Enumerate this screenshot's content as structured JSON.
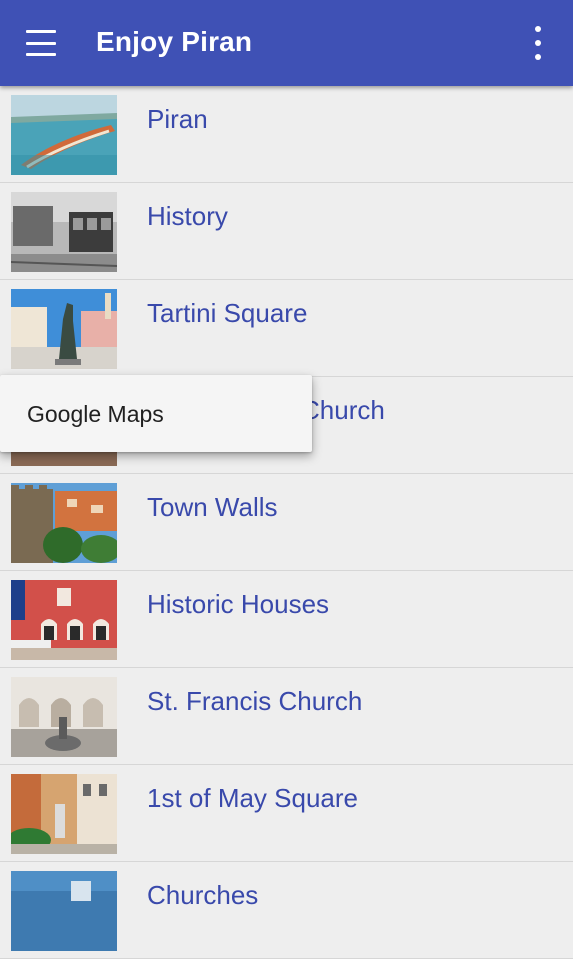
{
  "app_bar": {
    "title": "Enjoy Piran",
    "menu_icon": "hamburger-menu-icon",
    "overflow_icon": "more-vert-icon",
    "color": "#3f51b5"
  },
  "list": {
    "items": [
      {
        "label": "Piran",
        "thumb": "aerial-peninsula-photo"
      },
      {
        "label": "History",
        "thumb": "historic-tram-photo"
      },
      {
        "label": "Tartini Square",
        "thumb": "statue-square-photo"
      },
      {
        "label": "Church",
        "thumb": "church-photo"
      },
      {
        "label": "Town Walls",
        "thumb": "town-walls-photo"
      },
      {
        "label": "Historic Houses",
        "thumb": "venetian-house-photo"
      },
      {
        "label": "St. Francis Church",
        "thumb": "cloister-photo"
      },
      {
        "label": "1st of May Square",
        "thumb": "may-square-photo"
      },
      {
        "label": "Churches",
        "thumb": "churches-photo"
      }
    ]
  },
  "popup_menu": {
    "options": [
      "Google Maps"
    ]
  }
}
